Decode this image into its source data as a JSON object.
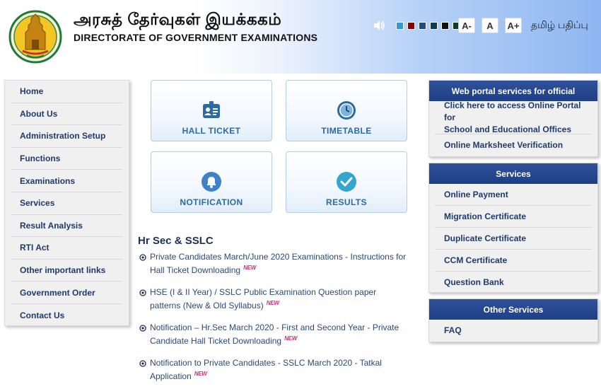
{
  "header": {
    "title_tamil": "அரசுத் தேர்வுகள் இயக்ககம்",
    "title_english": "DIRECTORATE OF GOVERNMENT EXAMINATIONS",
    "emblem_icon": "tamil-nadu-emblem-icon",
    "speaker_icon": "speaker-icon",
    "theme_colors": [
      "#2e9bd8",
      "#8b0000",
      "#1e4e79",
      "#0d3b4f",
      "#111111",
      "#123d22"
    ],
    "font_buttons": [
      "A-",
      "A",
      "A+"
    ],
    "language_link": "தமிழ் பதிப்பு"
  },
  "sidebar": {
    "items": [
      "Home",
      "About Us",
      "Administration Setup",
      "Functions",
      "Examinations",
      "Services",
      "Result Analysis",
      "RTI Act",
      "Other important links",
      "Government Order",
      "Contact Us"
    ]
  },
  "tiles": [
    {
      "label": "HALL TICKET",
      "icon": "id-badge-icon"
    },
    {
      "label": "TIMETABLE",
      "icon": "clock-icon"
    },
    {
      "label": "NOTIFICATION",
      "icon": "bell-icon"
    },
    {
      "label": "RESULTS",
      "icon": "checkmark-icon"
    }
  ],
  "news": {
    "title": "Hr Sec & SSLC",
    "new_badge": "NEW",
    "items": [
      {
        "line1": "Private Candidates March/June 2020 Examinations - Instructions for",
        "line2": "Hall Ticket Downloading"
      },
      {
        "line1": "HSE (I & II Year) / SSLC Public Examination Question paper",
        "line2": "patterns (New & Old Syllabus)"
      },
      {
        "line1": "Notification – Hr.Sec March 2020 - First and Second Year - Private",
        "line2": "Candidate Hall Ticket Downloading"
      },
      {
        "line1": "Notification to Private Candidates - SSLC March 2020 - Tatkal",
        "line2": "Application"
      }
    ]
  },
  "panels": {
    "official": {
      "title": "Web portal services for official",
      "items": [
        {
          "line1": "Click here to access Online Portal for",
          "line2": "School and Educational Offices"
        },
        {
          "line1": "Online Marksheet Verification",
          "line2": ""
        }
      ]
    },
    "services": {
      "title": "Services",
      "items": [
        "Online Payment",
        "Migration Certificate",
        "Duplicate Certificate",
        "CCM Certificate",
        "Question Bank"
      ]
    },
    "other": {
      "title": "Other Services",
      "items": [
        "FAQ"
      ]
    }
  }
}
